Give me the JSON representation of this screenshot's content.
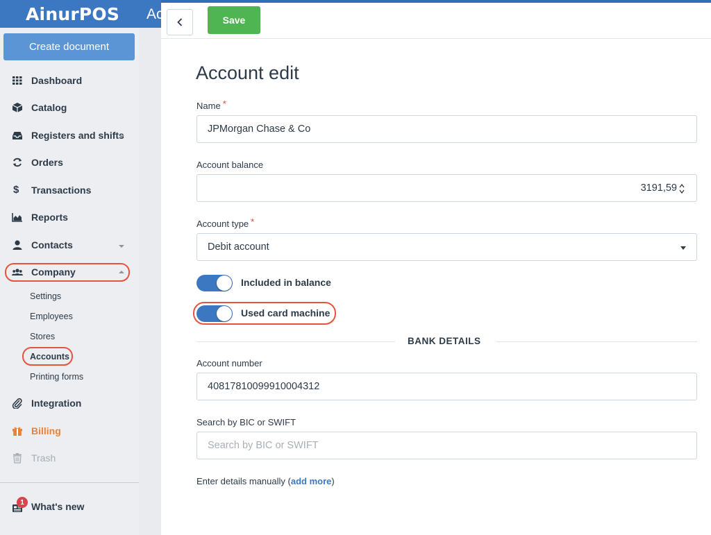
{
  "app": {
    "brand": "AinurPOS",
    "header_fragment": "Ac"
  },
  "sidebar": {
    "create_label": "Create document",
    "items": {
      "dashboard": "Dashboard",
      "catalog": "Catalog",
      "registers": "Registers and shifts",
      "orders": "Orders",
      "transactions": "Transactions",
      "reports": "Reports",
      "contacts": "Contacts",
      "company": "Company",
      "integration": "Integration",
      "billing": "Billing",
      "trash": "Trash",
      "whats_new": "What's new"
    },
    "company_sub": {
      "settings": "Settings",
      "employees": "Employees",
      "stores": "Stores",
      "accounts": "Accounts",
      "printing": "Printing forms"
    },
    "whats_new_badge": "1"
  },
  "toolbar": {
    "save_label": "Save"
  },
  "form": {
    "title": "Account edit",
    "name_label": "Name",
    "name_value": "JPMorgan Chase & Co",
    "balance_label": "Account balance",
    "balance_value": "3191,59",
    "type_label": "Account type",
    "type_value": "Debit account",
    "required_mark": "*",
    "toggle_included": "Included in balance",
    "toggle_card": "Used card machine",
    "bank_section": "BANK DETAILS",
    "account_number_label": "Account number",
    "account_number_value": "40817810099910004312",
    "bic_label": "Search by BIC or SWIFT",
    "bic_placeholder": "Search by BIC or SWIFT",
    "manual_prefix": "Enter details manually (",
    "manual_link": "add more",
    "manual_suffix": ")"
  },
  "colors": {
    "brand_blue": "#3c78c1",
    "save_green": "#4fb552",
    "billing_orange": "#e5833a",
    "highlight_red": "#e5533d"
  }
}
